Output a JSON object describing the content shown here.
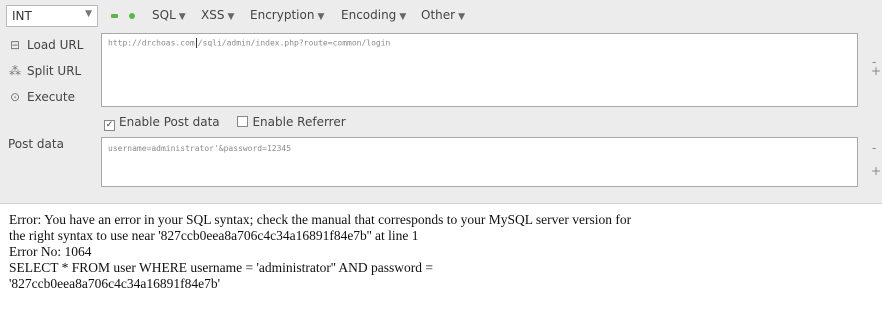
{
  "toolbar": {
    "int_select": "INT",
    "menus": [
      "SQL",
      "XSS",
      "Encryption",
      "Encoding",
      "Other"
    ]
  },
  "sidebar": {
    "load_url": "Load URL",
    "split_url": "Split URL",
    "execute": "Execute"
  },
  "url": {
    "before_cursor": "http://drchoas.com",
    "after_cursor": "/sqli/admin/index.php?route=common/login"
  },
  "options": {
    "enable_post": "Enable Post data",
    "enable_post_checked": true,
    "enable_referrer": "Enable Referrer",
    "enable_referrer_checked": false
  },
  "post": {
    "label": "Post data",
    "value": "username=administrator'&password=12345"
  },
  "controls": {
    "minus": "-",
    "plus": "+"
  },
  "output": {
    "line1": "Error: You have an error in your SQL syntax; check the manual that corresponds to your MySQL server version for",
    "line2": "the right syntax to use near '827ccb0eea8a706c4c34a16891f84e7b'' at line 1",
    "line3": "Error No: 1064",
    "line4": "SELECT * FROM user WHERE username = 'administrator'' AND password =",
    "line5": "'827ccb0eea8a706c4c34a16891f84e7b'"
  }
}
